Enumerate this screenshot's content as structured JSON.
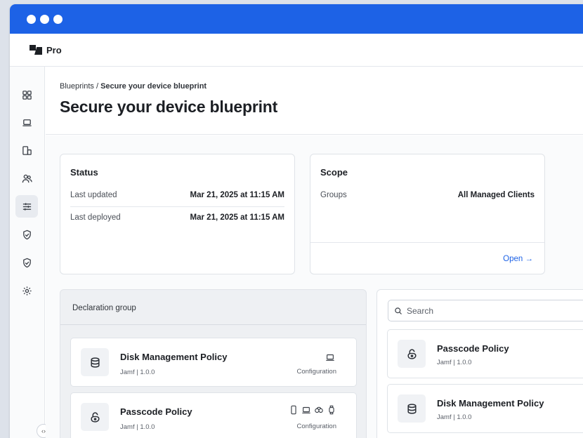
{
  "app": {
    "name": "Pro"
  },
  "breadcrumb": {
    "parent": "Blueprints",
    "separator": " / ",
    "current": "Secure your device blueprint"
  },
  "page": {
    "title": "Secure your device blueprint"
  },
  "sidebar": {
    "items": [
      {
        "icon": "dashboard-icon"
      },
      {
        "icon": "laptop-icon"
      },
      {
        "icon": "devices-icon"
      },
      {
        "icon": "users-icon"
      },
      {
        "icon": "sliders-icon",
        "active": true
      },
      {
        "icon": "shield-check-icon"
      },
      {
        "icon": "shield-check-icon"
      },
      {
        "icon": "gear-icon"
      }
    ],
    "collapse_label": "‹›"
  },
  "status": {
    "title": "Status",
    "rows": [
      {
        "label": "Last updated",
        "value": "Mar 21, 2025 at 11:15 AM"
      },
      {
        "label": "Last deployed",
        "value": "Mar 21, 2025 at 11:15 AM"
      }
    ]
  },
  "scope": {
    "title": "Scope",
    "rows": [
      {
        "label": "Groups",
        "value": "All Managed Clients"
      }
    ],
    "link": "Open →"
  },
  "declaration_group": {
    "label": "Declaration group",
    "items": [
      {
        "name": "Disk Management Policy",
        "meta": "Jamf | 1.0.0",
        "type": "Configuration",
        "icon": "database-icon"
      },
      {
        "name": "Passcode Policy",
        "meta": "Jamf | 1.0.0",
        "type": "Configuration",
        "icon": "passcode-icon"
      }
    ]
  },
  "library": {
    "search_placeholder": "Search",
    "items": [
      {
        "name": "Passcode Policy",
        "meta": "Jamf | 1.0.0",
        "icon": "passcode-icon"
      },
      {
        "name": "Disk Management Policy",
        "meta": "Jamf | 1.0.0",
        "icon": "database-icon"
      }
    ]
  },
  "colors": {
    "accent": "#1d62e6",
    "titlebar": "#1d62e6",
    "panel_gray": "#eef0f3"
  }
}
